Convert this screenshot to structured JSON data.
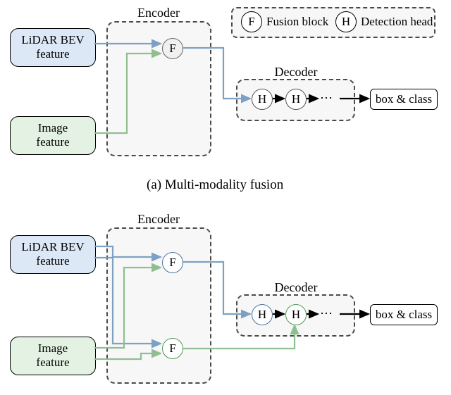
{
  "legend": {
    "fusion_letter": "F",
    "fusion_label": "Fusion block",
    "head_letter": "H",
    "head_label": "Detection head"
  },
  "labels": {
    "encoder": "Encoder",
    "decoder": "Decoder"
  },
  "blocks": {
    "lidar": "LiDAR BEV\nfeature",
    "image": "Image\nfeature",
    "output": "box & class"
  },
  "nodes": {
    "F": "F",
    "H": "H"
  },
  "ellipsis": "⋯",
  "caption_a": "(a) Multi-modality fusion"
}
